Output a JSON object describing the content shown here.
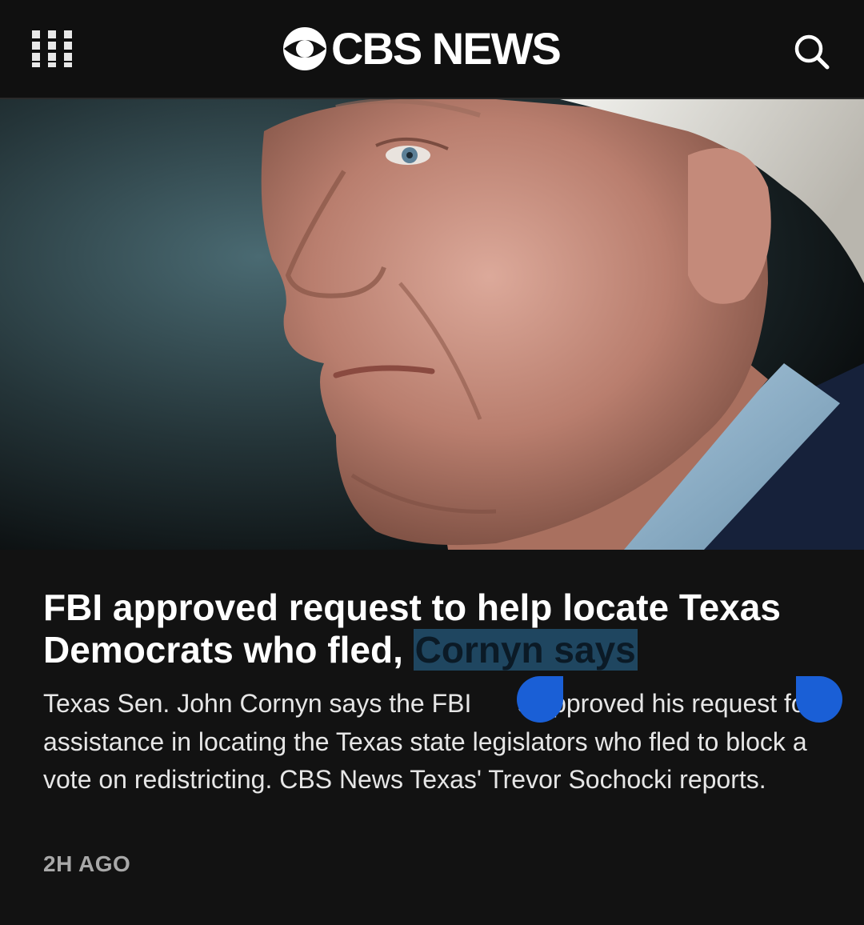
{
  "header": {
    "menu_icon": "grid-menu-icon",
    "logo_text": "CBS NEWS",
    "logo_icon": "cbs-eye-icon",
    "search_icon": "search-icon"
  },
  "article": {
    "image_description_icon": "hero-photo",
    "headline_part1": "FBI approved request to help locate Texas Democrats who fled, ",
    "headline_selected": "Cornyn says",
    "summary_part1": "Texas Sen. John Cornyn says the FBI",
    "summary_part2": "s approved his request for assistance in locating the Texas state legislators who fled to block a vote on redistricting. CBS News Texas' Trevor Sochocki reports.",
    "timestamp": "2H AGO"
  },
  "colors": {
    "background": "#121212",
    "selection_highlight": "#1f4660",
    "selection_handle": "#1a5fd6",
    "timestamp": "#a8a8a8"
  }
}
